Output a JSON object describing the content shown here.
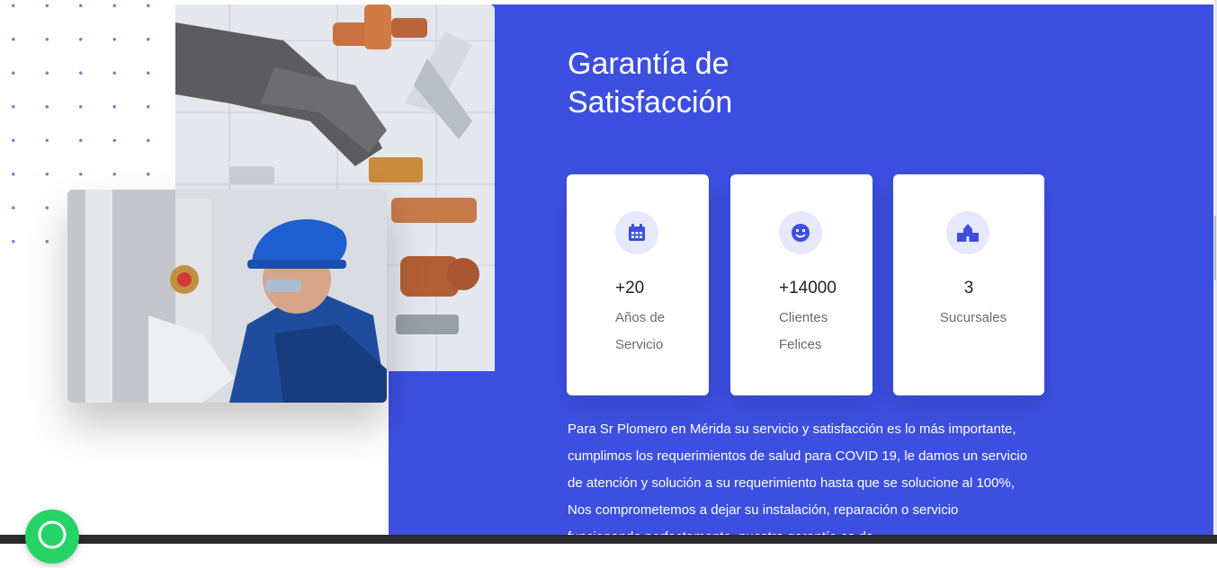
{
  "section": {
    "title": "Garantía de Satisfacción",
    "description": "Para Sr Plomero en Mérida su servicio y satisfacción es lo más importante, cumplimos los requerimientos de salud para COVID 19, le damos un servicio de atención y solución a su requerimiento hasta que se solucione al 100%, Nos comprometemos a dejar su instalación, reparación o servicio funcionando perfectamente, nuestra garantía es de"
  },
  "stats": [
    {
      "value": "+20",
      "label": "Años de Servicio",
      "icon": "calendar-icon"
    },
    {
      "value": "+14000",
      "label": "Clientes Felices",
      "icon": "smiley-icon"
    },
    {
      "value": "3",
      "label": "Sucursales",
      "icon": "branches-icon"
    }
  ],
  "colors": {
    "accent": "#3c4fe0",
    "icon_bg": "#e6e8fb",
    "whatsapp": "#25d366"
  }
}
